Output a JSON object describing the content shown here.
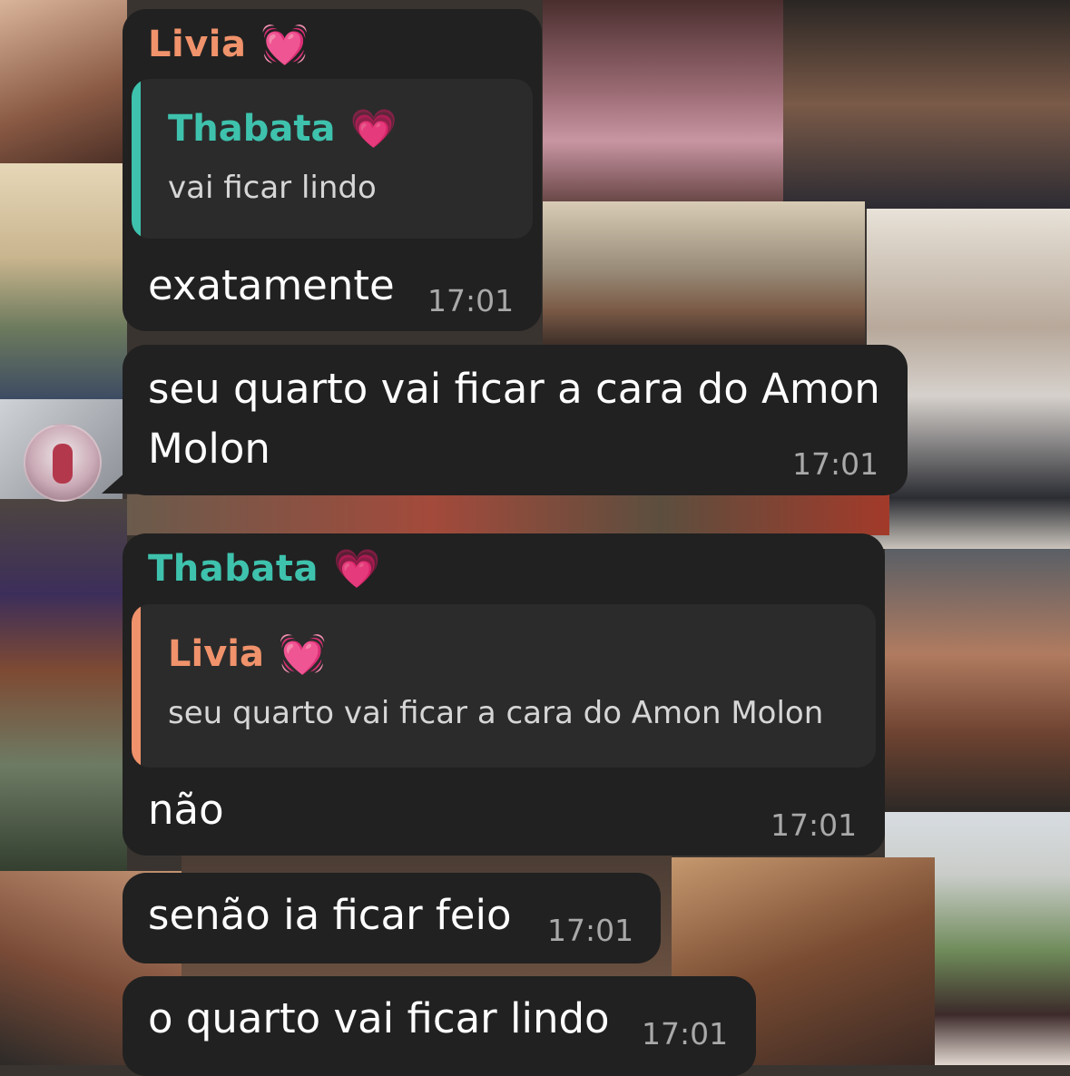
{
  "colors": {
    "bubble": "#212121",
    "quote_bg": "#2b2b2b",
    "livia": "#f0926b",
    "thabata": "#3ec2ad",
    "timestamp": "#a9a9a9"
  },
  "messages": [
    {
      "sender": "Livia",
      "sender_emoji": "💓",
      "reply_to": {
        "name": "Thabata",
        "emoji": "💗",
        "text": "vai ficar lindo"
      },
      "text": "exatamente",
      "time": "17:01"
    },
    {
      "text_line1": "seu quarto vai ficar a cara do Amon",
      "text_line2": "Molon",
      "time": "17:01",
      "avatar_icon": "contact-avatar"
    },
    {
      "sender": "Thabata",
      "sender_emoji": "💗",
      "reply_to": {
        "name": "Livia",
        "emoji": "💓",
        "text": "seu quarto vai ficar a cara do Amon Molon"
      },
      "text": "não",
      "time": "17:01"
    },
    {
      "text": "senão ia ficar feio",
      "time": "17:01"
    },
    {
      "text": "o quarto vai ficar lindo",
      "time": "17:01"
    }
  ]
}
